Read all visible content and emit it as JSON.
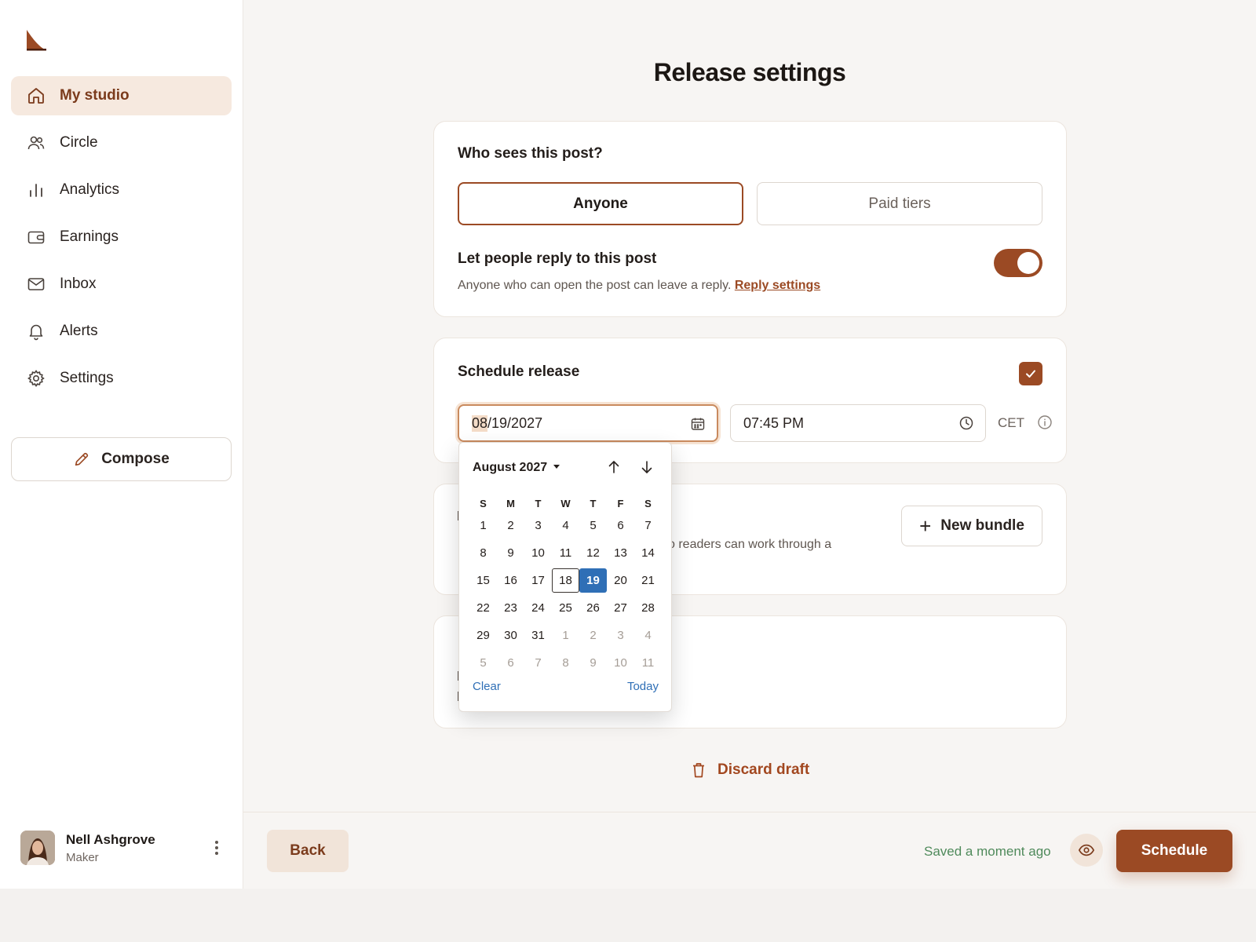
{
  "sidebar": {
    "items": [
      {
        "label": "My studio",
        "icon": "home-icon",
        "active": true
      },
      {
        "label": "Circle",
        "icon": "users-icon"
      },
      {
        "label": "Analytics",
        "icon": "bar-chart-icon"
      },
      {
        "label": "Earnings",
        "icon": "wallet-icon"
      },
      {
        "label": "Inbox",
        "icon": "mail-icon"
      },
      {
        "label": "Alerts",
        "icon": "bell-icon"
      },
      {
        "label": "Settings",
        "icon": "gear-icon"
      }
    ],
    "compose_label": "Compose"
  },
  "user": {
    "name": "Nell Ashgrove",
    "role": "Maker"
  },
  "page": {
    "title": "Release settings"
  },
  "audience": {
    "question": "Who sees this post?",
    "options": [
      "Anyone",
      "Paid tiers"
    ],
    "selected": "Anyone"
  },
  "replies": {
    "title": "Let people reply to this post",
    "description": "Anyone who can open the post can leave a reply.",
    "link": "Reply settings",
    "enabled": true
  },
  "schedule": {
    "title": "Schedule release",
    "checked": true,
    "date_month": "08",
    "date_rest": "/19/2027",
    "time": "07:45 PM",
    "timezone": "CET"
  },
  "bundle": {
    "partial_text": "o readers can work through a",
    "button_label": "New bundle"
  },
  "calendar": {
    "month_label": "August 2027",
    "weekdays": [
      "S",
      "M",
      "T",
      "W",
      "T",
      "F",
      "S"
    ],
    "weeks": [
      [
        "1",
        "2",
        "3",
        "4",
        "5",
        "6",
        "7"
      ],
      [
        "8",
        "9",
        "10",
        "11",
        "12",
        "13",
        "14"
      ],
      [
        "15",
        "16",
        "17",
        "18",
        "19",
        "20",
        "21"
      ],
      [
        "22",
        "23",
        "24",
        "25",
        "26",
        "27",
        "28"
      ],
      [
        "29",
        "30",
        "31",
        "1",
        "2",
        "3",
        "4"
      ],
      [
        "5",
        "6",
        "7",
        "8",
        "9",
        "10",
        "11"
      ]
    ],
    "today": "18",
    "selected": "19",
    "clear_label": "Clear",
    "today_label": "Today"
  },
  "actions": {
    "discard_label": "Discard draft",
    "back_label": "Back",
    "saved_status": "Saved a moment ago",
    "schedule_label": "Schedule"
  },
  "colors": {
    "accent": "#9b4a24",
    "selected_day": "#2f6fb6",
    "saved_text": "#4f8a5b"
  }
}
